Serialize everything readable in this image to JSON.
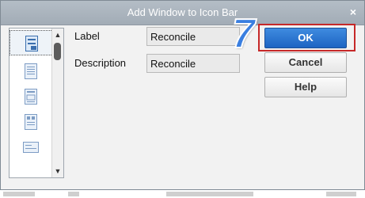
{
  "dialog": {
    "title": "Add Window to Icon Bar",
    "close_glyph": "×"
  },
  "icon_list": {
    "icons": [
      "document-icon",
      "report-icon",
      "register-icon",
      "form-icon",
      "check-icon"
    ],
    "scroll_up_glyph": "▲",
    "scroll_down_glyph": "▼"
  },
  "form": {
    "label_caption": "Label",
    "label_value": "Reconcile",
    "description_caption": "Description",
    "description_value": "Reconcile"
  },
  "buttons": {
    "ok": "OK",
    "cancel": "Cancel",
    "help": "Help"
  },
  "annotation": {
    "step_number": "7",
    "highlight_color": "#c62828",
    "step_color": "#3a7fe0"
  }
}
